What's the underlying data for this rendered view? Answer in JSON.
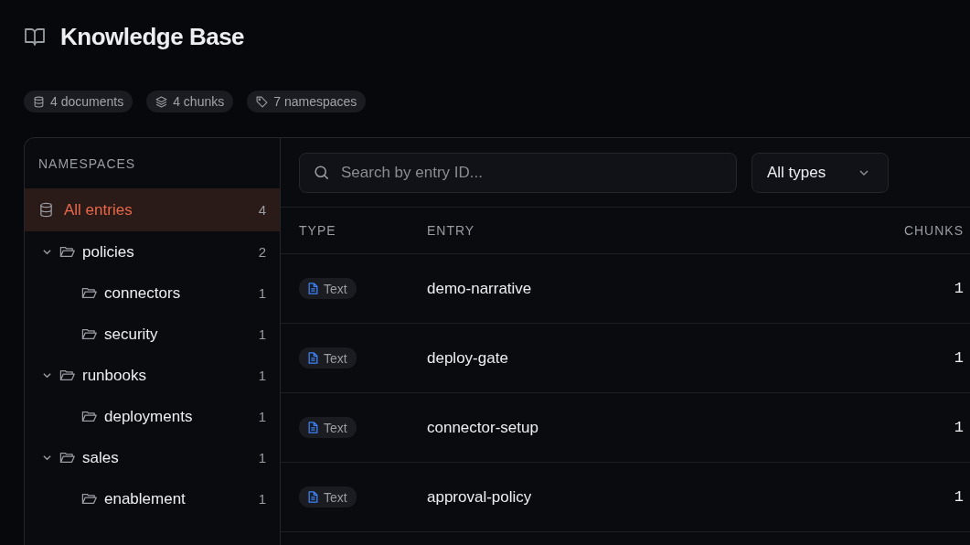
{
  "header": {
    "title": "Knowledge Base"
  },
  "stats": [
    {
      "kind": "documents",
      "label": "4 documents"
    },
    {
      "kind": "chunks",
      "label": "4 chunks"
    },
    {
      "kind": "namespaces",
      "label": "7 namespaces"
    }
  ],
  "sidebar": {
    "heading": "NAMESPACES",
    "all_entries": {
      "label": "All entries",
      "count": "4",
      "selected": true
    },
    "tree": [
      {
        "label": "policies",
        "count": "2",
        "expanded": true,
        "selected": false,
        "children": [
          {
            "label": "connectors",
            "count": "1",
            "selected": false
          },
          {
            "label": "security",
            "count": "1",
            "selected": false
          }
        ]
      },
      {
        "label": "runbooks",
        "count": "1",
        "expanded": true,
        "selected": false,
        "children": [
          {
            "label": "deployments",
            "count": "1",
            "selected": false
          }
        ]
      },
      {
        "label": "sales",
        "count": "1",
        "expanded": true,
        "selected": false,
        "children": [
          {
            "label": "enablement",
            "count": "1",
            "selected": false
          }
        ]
      }
    ]
  },
  "search": {
    "placeholder": "Search by entry ID..."
  },
  "type_filter": {
    "value": "All types"
  },
  "table": {
    "columns": [
      "TYPE",
      "ENTRY",
      "CHUNKS"
    ],
    "rows": [
      {
        "type": "Text",
        "entry": "demo-narrative",
        "chunks": "1"
      },
      {
        "type": "Text",
        "entry": "deploy-gate",
        "chunks": "1"
      },
      {
        "type": "Text",
        "entry": "connector-setup",
        "chunks": "1"
      },
      {
        "type": "Text",
        "entry": "approval-policy",
        "chunks": "1"
      }
    ]
  }
}
